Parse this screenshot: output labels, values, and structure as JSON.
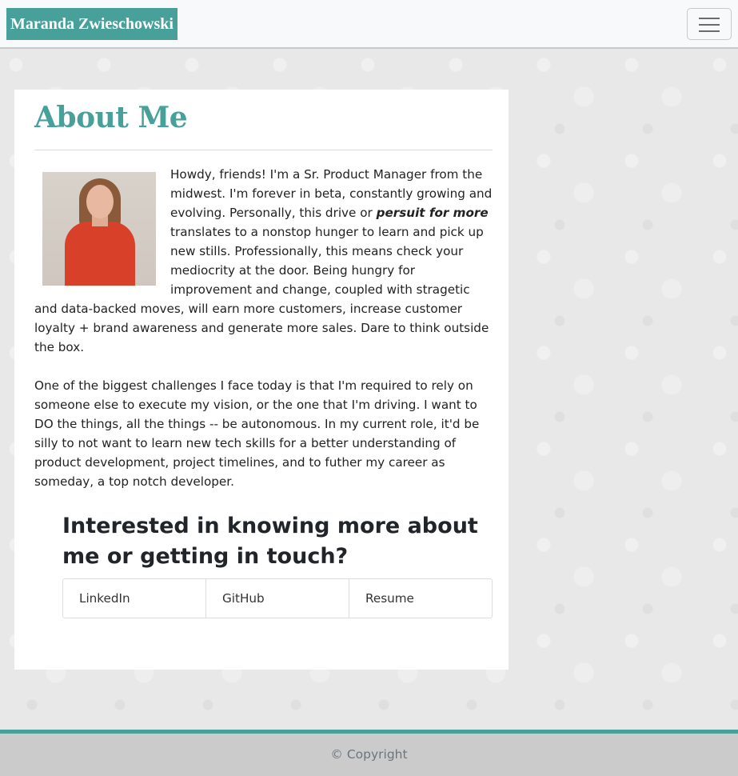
{
  "navbar": {
    "brand": "Maranda Zwieschowski",
    "toggler_icon": "hamburger-menu-icon"
  },
  "about": {
    "title": "About Me",
    "photo": "profile-photo",
    "paragraph1_before": "Howdy, friends! I'm a Sr. Product Manager from the midwest. I'm forever in beta, constantly growing and evolving. Personally, this drive or ",
    "paragraph1_emphasis": "persuit for more",
    "paragraph1_after": " translates to a nonstop hunger to learn and pick up new stills. Professionally, this means check your mediocrity at the door. Being hungry for improvement and change, coupled with stragetic and data-backed moves, will earn more customers, increase customer loyalty + brand awareness and generate more sales. Dare to think outside the box.",
    "paragraph2": "One of the biggest challenges I face today is that I'm required to rely on someone else to execute my vision, or the one that I'm driving. I want to DO the things, all the things -- be autonomous. In my current role, it'd be silly to not want to learn new tech skills for a better understanding of product development, project timelines, and to futher my career as someday, a top notch developer."
  },
  "contact": {
    "heading": "Interested in knowing more about me or getting in touch?",
    "links": [
      {
        "label": "LinkedIn"
      },
      {
        "label": "GitHub"
      },
      {
        "label": "Resume"
      }
    ]
  },
  "footer": {
    "text": "© Copyright"
  },
  "colors": {
    "accent": "#47a19a",
    "footer_bg": "#cbcbcb"
  }
}
